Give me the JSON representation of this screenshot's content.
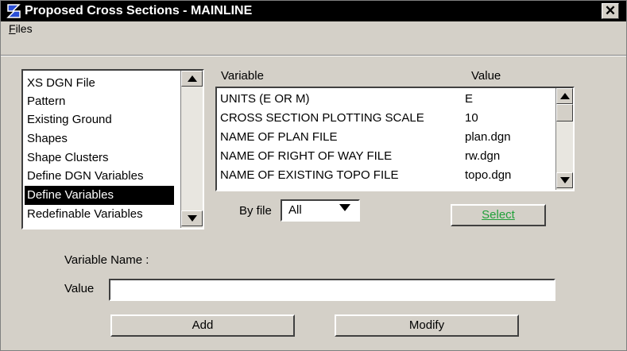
{
  "window": {
    "title": "Proposed Cross Sections - MAINLINE",
    "close_label": "✕"
  },
  "menu": {
    "files_first_letter": "F",
    "files_rest": "iles"
  },
  "category_list": {
    "items": [
      "XS DGN File",
      "Pattern",
      "Existing Ground",
      "Shapes",
      "Shape Clusters",
      "Define DGN Variables",
      "Define Variables",
      "Redefinable Variables"
    ],
    "selected": "Define Variables"
  },
  "variables_table": {
    "headers": {
      "variable": "Variable",
      "value": "Value"
    },
    "rows": [
      {
        "name": "UNITS (E OR M)",
        "value": "E"
      },
      {
        "name": "CROSS SECTION PLOTTING SCALE",
        "value": "10"
      },
      {
        "name": "NAME OF PLAN FILE",
        "value": "plan.dgn"
      },
      {
        "name": "NAME OF RIGHT OF WAY FILE",
        "value": "rw.dgn"
      },
      {
        "name": "NAME OF EXISTING TOPO FILE",
        "value": "topo.dgn"
      }
    ]
  },
  "filter": {
    "by_file_label": "By file",
    "by_file_value": "All",
    "select_label": "Select"
  },
  "form": {
    "variable_name_label": "Variable Name :",
    "value_label": "Value",
    "value_input": ""
  },
  "actions": {
    "add_label": "Add",
    "modify_label": "Modify"
  },
  "colors": {
    "titlebar": "#000000",
    "dialog_face": "#d4d0c8",
    "selection": "#000000",
    "select_button_text": "#21a03a",
    "app_icon": "#2b4fd6"
  }
}
